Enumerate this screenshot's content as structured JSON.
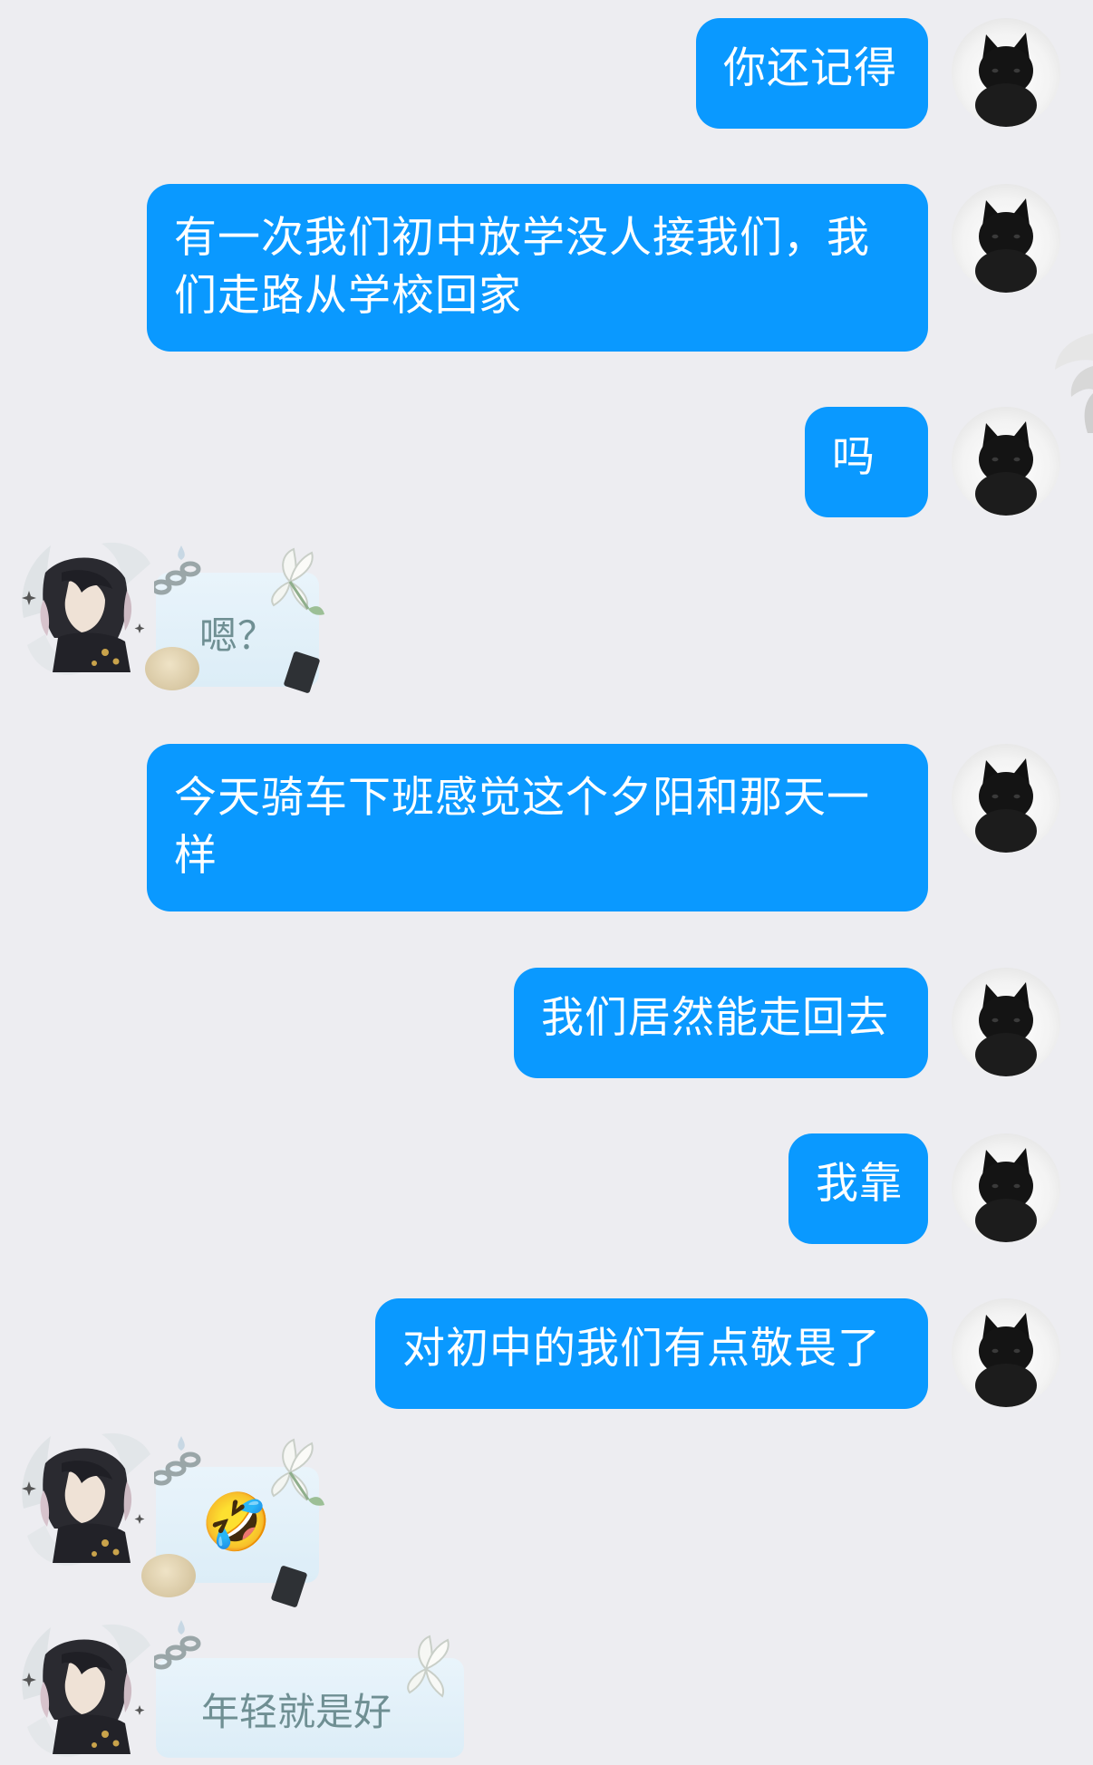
{
  "messages": [
    {
      "side": "me",
      "text": "你还记得"
    },
    {
      "side": "me",
      "text": "有一次我们初中放学没人接我们，我们走路从学校回家",
      "line1": "有一次我们初中放学没人接我们，我",
      "line2": "们走路从学校回家"
    },
    {
      "side": "me",
      "text": "吗"
    },
    {
      "side": "other",
      "text": "嗯？"
    },
    {
      "side": "me",
      "text": "今天骑车下班感觉这个夕阳和那天一样",
      "line1": "今天骑车下班感觉这个夕阳和那天一",
      "line2": "样"
    },
    {
      "side": "me",
      "text": "我们居然能走回去"
    },
    {
      "side": "me",
      "text": "我靠"
    },
    {
      "side": "me",
      "text": "对初中的我们有点敬畏了"
    },
    {
      "side": "other",
      "text": "🤣"
    },
    {
      "side": "other",
      "text": "年轻就是好"
    }
  ],
  "avatars": {
    "me": "black-cat-avatar",
    "other": "anime-character-avatar"
  },
  "colors": {
    "background": "#ededf1",
    "bubble_me": "#0a99ff",
    "bubble_text_me": "#ffffff"
  }
}
